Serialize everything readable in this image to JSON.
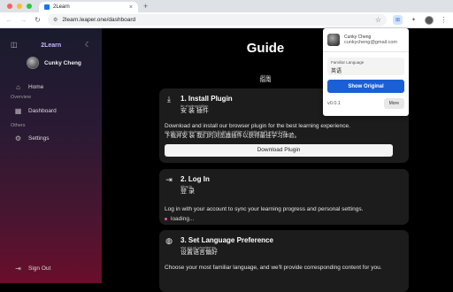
{
  "browser": {
    "tab_title": "2Learn",
    "tab_close": "×",
    "new_tab": "+",
    "back": "←",
    "forward": "→",
    "reload": "↻",
    "url": "2learn.leaper.one/dashboard",
    "bookmark": "☆",
    "site_settings": "⚙",
    "ext_active": "⊞",
    "ext_puzzle": "✦"
  },
  "sidebar": {
    "brand": "2Learn",
    "toggle_icon": "◫",
    "theme_icon": "☾",
    "user_name": "Cunky Cheng",
    "items": [
      {
        "label": "Home",
        "icon": "⌂"
      },
      {
        "label": "Dashboard",
        "icon": "▦"
      },
      {
        "label": "Settings",
        "icon": "⚙"
      }
    ],
    "sections": [
      "Overview",
      "Others"
    ],
    "sign_out": "Sign Out",
    "sign_out_icon": "⇥"
  },
  "main": {
    "title": "Guide",
    "title_pinyin": "zhǐnán",
    "title_cn": "指南",
    "cards": [
      {
        "icon": "⤓",
        "title": "1. Install Plugin",
        "title_pinyin": "ān zhuāngchājiàn",
        "title_cn": "安 装 插件",
        "desc": "Download and install our browser plugin for the best learning experience.",
        "desc_pinyin": "xià zài bìng ān zhuāngwǒmen de liú lǎn qì chājiàn yǐ huòdé zuì jiā xué xí tǐ yàn",
        "desc_cn": "下载并安 装 我们的浏览器插件以获得最佳学习体验。",
        "button": "Download Plugin"
      },
      {
        "icon": "⇥",
        "title": "2. Log In",
        "title_pinyin": "dēng lù",
        "title_cn": "登 录",
        "desc": "Log in with your account to sync your learning progress and personal settings.",
        "loading": "loading..."
      },
      {
        "icon": "◍",
        "title": "3. Set Language Preference",
        "title_pinyin": "shè zhì yǔ yánpiānhǎo",
        "title_cn": "设置语言偏好",
        "desc": "Choose your most familiar language, and we'll provide corresponding content for you."
      }
    ]
  },
  "popup": {
    "user_name": "Cunky Cheng",
    "email": "cunkycheng@gmail.com",
    "familiar_label": "Familiar Language",
    "familiar_value": "英语",
    "show_original": "Show Original",
    "version": "v0.0.1",
    "more": "More"
  },
  "colors": {
    "accent": "#1a5fd6",
    "loading_dot": "#ff4d9e",
    "brand": "#c9b3ff"
  }
}
